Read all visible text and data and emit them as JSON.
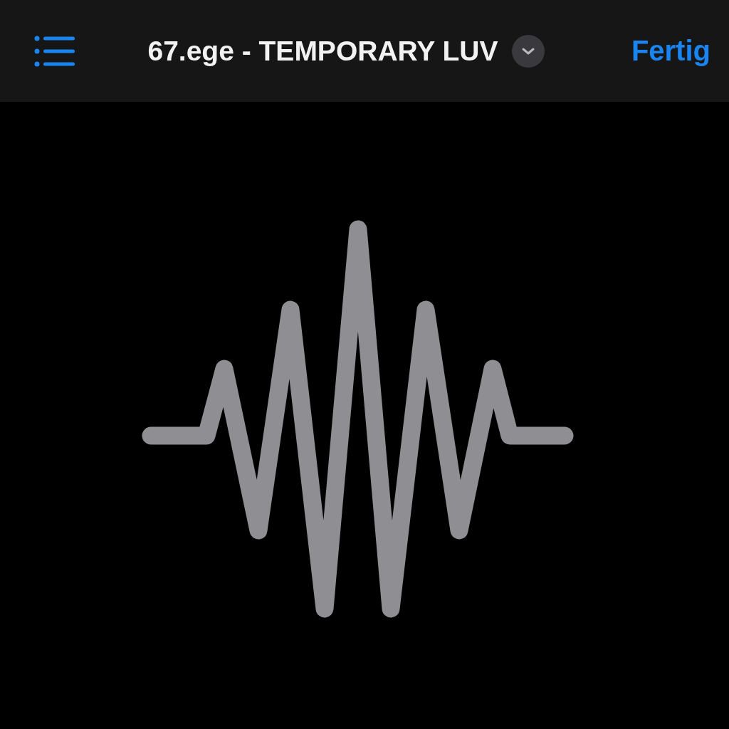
{
  "navigation_bar": {
    "title": "67.ege - TEMPORARY LUV",
    "done_button": "Fertig"
  }
}
